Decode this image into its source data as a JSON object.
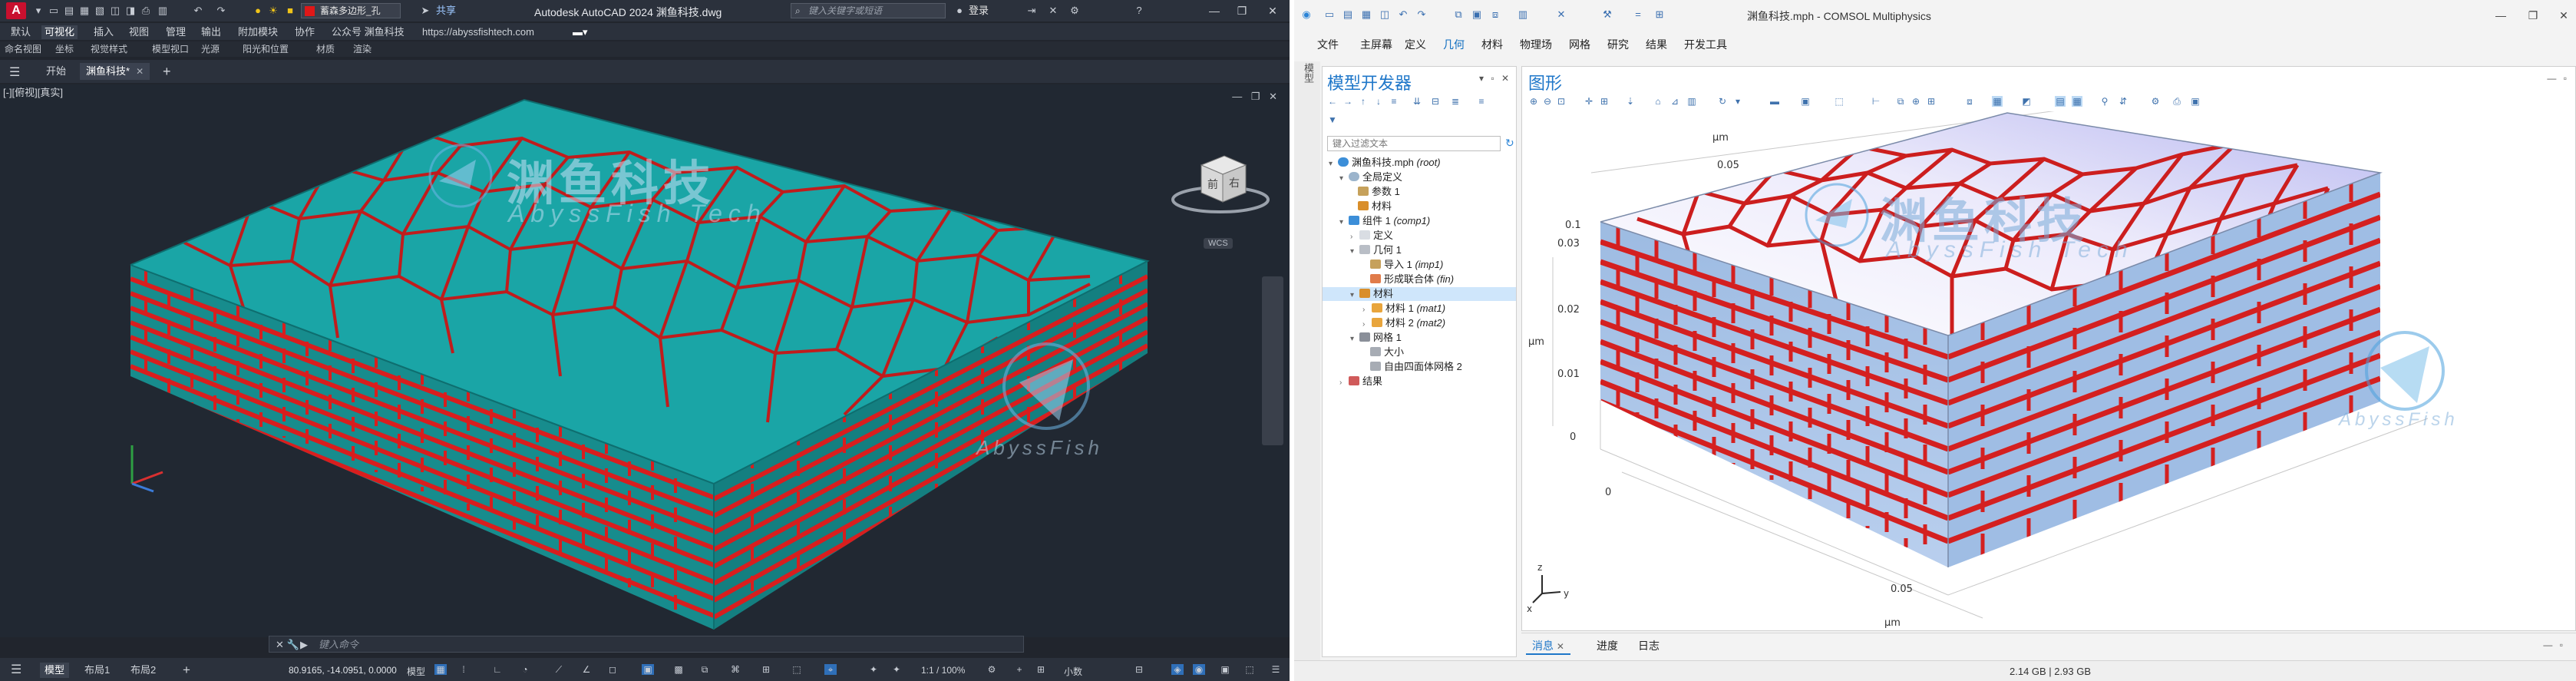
{
  "autocad": {
    "window_title": "Autodesk AutoCAD 2024   渊鱼科技.dwg",
    "layer_name": "蓄森多边形_孔",
    "share_label": "共享",
    "search_placeholder": "键入关键字或短语",
    "user_label": "登录",
    "ribbon_tabs": [
      "默认",
      "可视化",
      "插入",
      "视图",
      "管理",
      "输出",
      "附加模块",
      "协作",
      "公众号 渊鱼科技"
    ],
    "active_ribbon_tab": "可视化",
    "url_text": "https://abyssfishtech.com",
    "subribbon": [
      "命名视图",
      "坐标",
      "视觉样式",
      "模型视口",
      "光源",
      "阳光和位置",
      "材质",
      "渲染"
    ],
    "doc_tabs": [
      {
        "label": "开始"
      },
      {
        "label": "渊鱼科技*",
        "active": true
      }
    ],
    "viewport_label": "[-][俯视][真实]",
    "viewcube_faces": [
      "前",
      "右"
    ],
    "wcs_label": "WCS",
    "watermark_cn": "渊鱼科技",
    "watermark_en": "AbyssFish Tech",
    "watermark_small": "AbyssFish",
    "command_placeholder": "键入命令",
    "status_tabs": [
      "模型",
      "布局1",
      "布局2"
    ],
    "coords": "80.9165, -14.0951, 0.0000",
    "model_label": "模型",
    "scale": "1:1 / 100%",
    "units": "小数",
    "colors": {
      "mortar": "#d81e1e",
      "brick_top": "#1aa5a6",
      "brick_side": "#178c8d",
      "viewport_bg": "#212832"
    }
  },
  "comsol": {
    "window_title": "渊鱼科技.mph - COMSOL Multiphysics",
    "menu": [
      "文件",
      "主屏幕",
      "定义",
      "几何",
      "材料",
      "物理场",
      "网格",
      "研究",
      "结果",
      "开发工具"
    ],
    "left_rail": "模型",
    "model_builder_title": "模型开发器",
    "filter_placeholder": "键入过滤文本",
    "tree": [
      {
        "label": "渊鱼科技.mph",
        "tag": "(root)",
        "level": 0
      },
      {
        "label": "全局定义",
        "level": 1
      },
      {
        "label": "参数 1",
        "level": 2
      },
      {
        "label": "材料",
        "level": 2
      },
      {
        "label": "组件 1",
        "tag": "(comp1)",
        "level": 1
      },
      {
        "label": "定义",
        "level": 2
      },
      {
        "label": "几何 1",
        "level": 2
      },
      {
        "label": "导入 1",
        "tag": "(imp1)",
        "level": 3
      },
      {
        "label": "形成联合体",
        "tag": "(fin)",
        "level": 3
      },
      {
        "label": "材料",
        "level": 2,
        "selected": true
      },
      {
        "label": "材料 1",
        "tag": "(mat1)",
        "level": 3
      },
      {
        "label": "材料 2",
        "tag": "(mat2)",
        "level": 3
      },
      {
        "label": "网格 1",
        "level": 2
      },
      {
        "label": "大小",
        "level": 3
      },
      {
        "label": "自由四面体网格 2",
        "level": 3
      },
      {
        "label": "结果",
        "level": 1
      }
    ],
    "graphics_title": "图形",
    "axis_labels": {
      "unit_top": "μm",
      "top_tick": "0.05",
      "z_ticks": [
        "0.1",
        "0.03",
        "0.02",
        "0.01",
        "0"
      ],
      "unit_left": "μm",
      "x0": "0",
      "x_tick": "0.05",
      "unit_bottom": "μm"
    },
    "triad": {
      "z": "z",
      "x": "x",
      "y": "y"
    },
    "watermark_cn": "渊鱼科技",
    "watermark_en": "AbyssFish Tech",
    "watermark_small": "AbyssFish",
    "bottom_tabs": [
      "消息",
      "进度",
      "日志"
    ],
    "memory": "2.14 GB | 2.93 GB",
    "colors": {
      "mortar": "#d42020",
      "brick": "#a9c3e6",
      "brick_side": "#8fb0da",
      "top_a": "#ffffff",
      "top_b": "#c7c8f4",
      "accent": "#1f77c9"
    }
  }
}
